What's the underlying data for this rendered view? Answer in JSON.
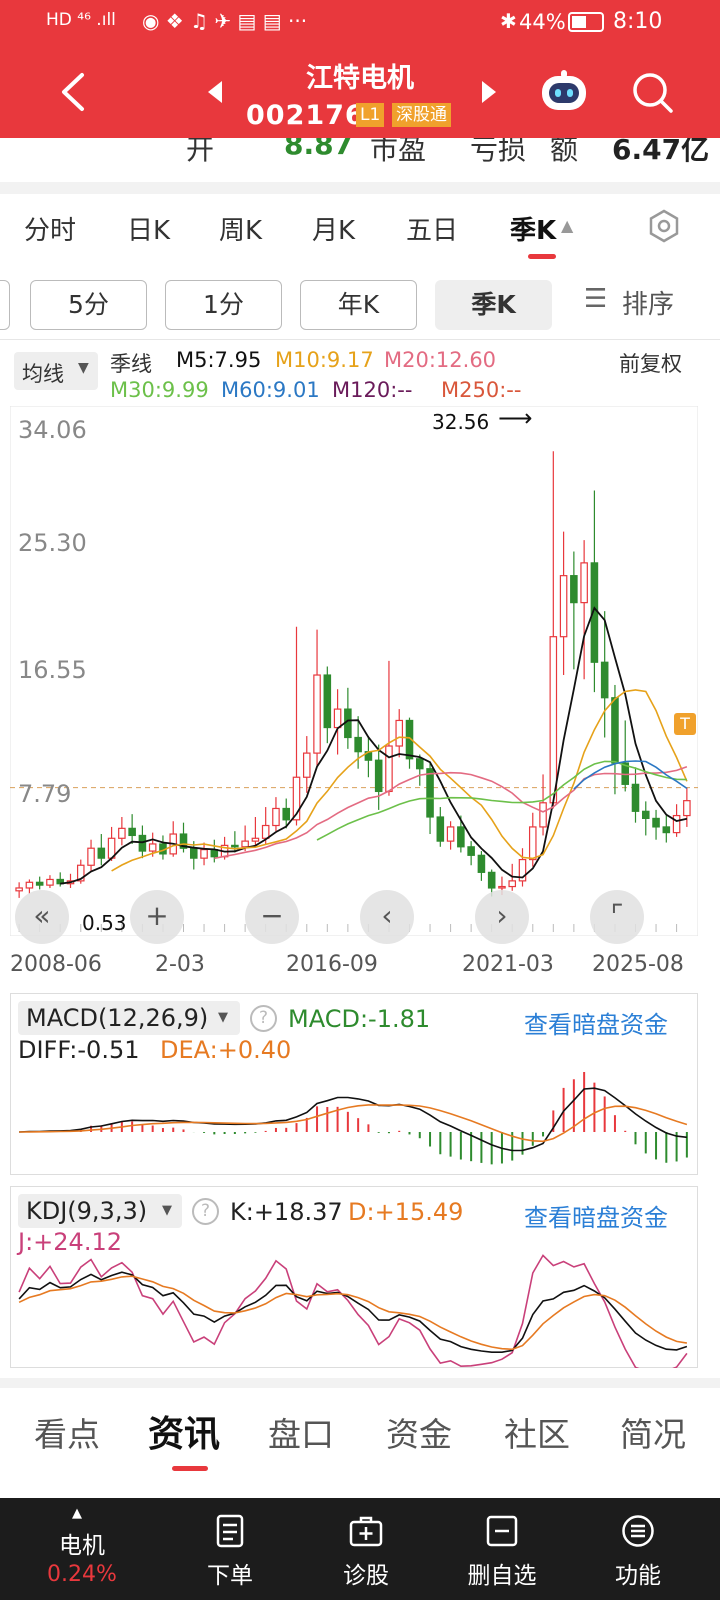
{
  "status_bar": {
    "left_icons": "HD ⁴⁶ .ıll",
    "battery": "44%",
    "time": "8:10"
  },
  "header": {
    "stock_name": "江特电机",
    "stock_code": "002176",
    "level_badge": "L1",
    "connect_badge": "深股通"
  },
  "quote_row": {
    "label_open": "开",
    "open_value": "8.87",
    "label_pe": "市盈",
    "pe_value": "亏损",
    "label_amount": "额",
    "amount_value": "6.47亿"
  },
  "period_tabs": [
    "分时",
    "日K",
    "周K",
    "月K",
    "五日",
    "季K"
  ],
  "selected_period": "季K",
  "chips": [
    "5分",
    "1分",
    "年K",
    "季K"
  ],
  "sort_label": "排序",
  "ma": {
    "dropdown": "均线",
    "period_label": "季线",
    "adjust": "前复权",
    "m5": "M5:7.95",
    "m10": "M10:9.17",
    "m20": "M20:12.60",
    "m30": "M30:9.99",
    "m60": "M60:9.01",
    "m120": "M120:--",
    "m250": "M250:--"
  },
  "price_axis": [
    "34.06",
    "25.30",
    "16.55",
    "7.79"
  ],
  "high_marker": "32.56",
  "low_marker": "0.53",
  "dates": [
    "2008-06",
    "2-03",
    "2016-09",
    "2021-03",
    "2025-08"
  ],
  "t_marker": "T",
  "macd": {
    "title": "MACD(12,26,9)",
    "macd": "MACD:-1.81",
    "diff": "DIFF:-0.51",
    "dea": "DEA:+0.40",
    "link": "查看暗盘资金"
  },
  "kdj": {
    "title": "KDJ(9,3,3)",
    "k": "K:+18.37",
    "d": "D:+15.49",
    "j": "J:+24.12",
    "link": "查看暗盘资金"
  },
  "bottom_tabs": [
    "看点",
    "资讯",
    "盘口",
    "资金",
    "社区",
    "简况"
  ],
  "selected_tab": "资讯",
  "bottom_nav": {
    "stock_label": "电机",
    "stock_change": "0.24%",
    "items": [
      "下单",
      "诊股",
      "删自选",
      "功能"
    ]
  },
  "colors": {
    "brand_red": "#e8383d",
    "up": "#e8383d",
    "down": "#2e8b2e",
    "m5": "#111111",
    "m10": "#e6a21a",
    "m20": "#e36b82",
    "m30": "#6cc04a",
    "m60": "#2b78c4",
    "m120": "#6a1b5a",
    "m250": "#d9573b",
    "link": "#2b7fd6"
  },
  "chart_data": {
    "type": "candlestick",
    "title": "江特电机 季K",
    "ylim": [
      0.53,
      34.06
    ],
    "y_ticks": [
      34.06,
      25.3,
      16.55,
      7.79
    ],
    "x_ticks": [
      "2008-06",
      "2016-09",
      "2021-03",
      "2025-08"
    ],
    "high": 32.56,
    "low": 0.53,
    "candles": [
      [
        1.6,
        1.8,
        2.2,
        1.1
      ],
      [
        1.8,
        2.2,
        2.4,
        1.4
      ],
      [
        2.2,
        2.0,
        2.6,
        1.7
      ],
      [
        2.0,
        2.4,
        2.7,
        1.8
      ],
      [
        2.4,
        2.1,
        2.9,
        1.9
      ],
      [
        2.1,
        2.3,
        2.8,
        1.8
      ],
      [
        2.3,
        3.4,
        3.8,
        2.1
      ],
      [
        3.4,
        4.6,
        5.2,
        3.0
      ],
      [
        4.6,
        3.9,
        5.6,
        3.4
      ],
      [
        3.9,
        5.3,
        6.1,
        3.7
      ],
      [
        5.3,
        6.0,
        6.8,
        4.8
      ],
      [
        6.0,
        5.5,
        7.0,
        4.9
      ],
      [
        5.5,
        4.4,
        6.2,
        3.9
      ],
      [
        4.4,
        4.9,
        5.7,
        4.0
      ],
      [
        4.9,
        4.2,
        5.5,
        3.8
      ],
      [
        4.2,
        5.6,
        6.5,
        4.0
      ],
      [
        5.6,
        4.6,
        6.4,
        4.3
      ],
      [
        4.6,
        3.9,
        5.1,
        3.1
      ],
      [
        3.9,
        4.5,
        5.0,
        3.4
      ],
      [
        4.5,
        4.0,
        5.2,
        3.6
      ],
      [
        4.0,
        4.8,
        5.4,
        3.8
      ],
      [
        4.8,
        4.7,
        5.8,
        4.3
      ],
      [
        4.7,
        5.1,
        6.2,
        4.4
      ],
      [
        5.1,
        5.3,
        6.8,
        4.8
      ],
      [
        5.3,
        6.2,
        7.5,
        4.9
      ],
      [
        6.2,
        7.4,
        8.2,
        5.8
      ],
      [
        7.4,
        6.6,
        8.1,
        6.0
      ],
      [
        6.6,
        9.6,
        20.2,
        6.2
      ],
      [
        9.6,
        11.3,
        12.5,
        8.5
      ],
      [
        11.3,
        16.8,
        20.0,
        10.4
      ],
      [
        16.8,
        13.1,
        17.4,
        12.0
      ],
      [
        13.1,
        14.4,
        15.8,
        11.2
      ],
      [
        14.4,
        12.4,
        15.9,
        11.6
      ],
      [
        12.4,
        11.4,
        13.9,
        10.2
      ],
      [
        11.4,
        10.8,
        12.5,
        9.6
      ],
      [
        10.8,
        8.6,
        11.9,
        7.3
      ],
      [
        8.6,
        11.8,
        17.8,
        8.3
      ],
      [
        11.8,
        13.6,
        14.4,
        11.0
      ],
      [
        13.6,
        10.9,
        13.8,
        10.2
      ],
      [
        10.9,
        10.2,
        11.2,
        9.0
      ],
      [
        10.2,
        6.8,
        10.6,
        5.6
      ],
      [
        6.8,
        5.1,
        7.5,
        4.7
      ],
      [
        5.1,
        6.1,
        6.5,
        4.5
      ],
      [
        6.1,
        4.7,
        6.9,
        4.3
      ],
      [
        4.7,
        4.1,
        5.1,
        3.4
      ],
      [
        4.1,
        2.9,
        4.4,
        2.3
      ],
      [
        2.9,
        1.8,
        3.1,
        1.2
      ],
      [
        1.8,
        1.9,
        2.6,
        1.3
      ],
      [
        1.9,
        2.3,
        3.5,
        1.6
      ],
      [
        2.3,
        3.8,
        4.6,
        1.9
      ],
      [
        3.8,
        6.1,
        7.1,
        3.3
      ],
      [
        6.1,
        7.8,
        9.8,
        5.5
      ],
      [
        7.8,
        19.5,
        32.56,
        7.4
      ],
      [
        19.5,
        23.8,
        26.9,
        16.8
      ],
      [
        23.8,
        21.9,
        25.5,
        17.2
      ],
      [
        21.9,
        24.7,
        26.3,
        16.5
      ],
      [
        24.7,
        17.7,
        29.8,
        15.6
      ],
      [
        17.7,
        15.2,
        21.3,
        12.4
      ],
      [
        15.2,
        10.6,
        16.1,
        8.4
      ],
      [
        10.6,
        9.1,
        13.6,
        8.6
      ],
      [
        9.1,
        7.2,
        10.3,
        6.4
      ],
      [
        7.2,
        6.7,
        7.9,
        5.5
      ],
      [
        6.7,
        6.1,
        7.3,
        5.2
      ],
      [
        6.1,
        5.7,
        6.9,
        5.0
      ],
      [
        5.7,
        6.9,
        7.7,
        5.4
      ],
      [
        6.9,
        7.95,
        8.87,
        6.1
      ]
    ],
    "ma_series": [
      {
        "name": "M5",
        "last": 7.95
      },
      {
        "name": "M10",
        "last": 9.17
      },
      {
        "name": "M20",
        "last": 12.6
      },
      {
        "name": "M30",
        "last": 9.99
      },
      {
        "name": "M60",
        "last": 9.01
      }
    ],
    "indicators": {
      "MACD": {
        "MACD": -1.81,
        "DIFF": -0.51,
        "DEA": 0.4
      },
      "KDJ": {
        "K": 18.37,
        "D": 15.49,
        "J": 24.12
      }
    }
  }
}
